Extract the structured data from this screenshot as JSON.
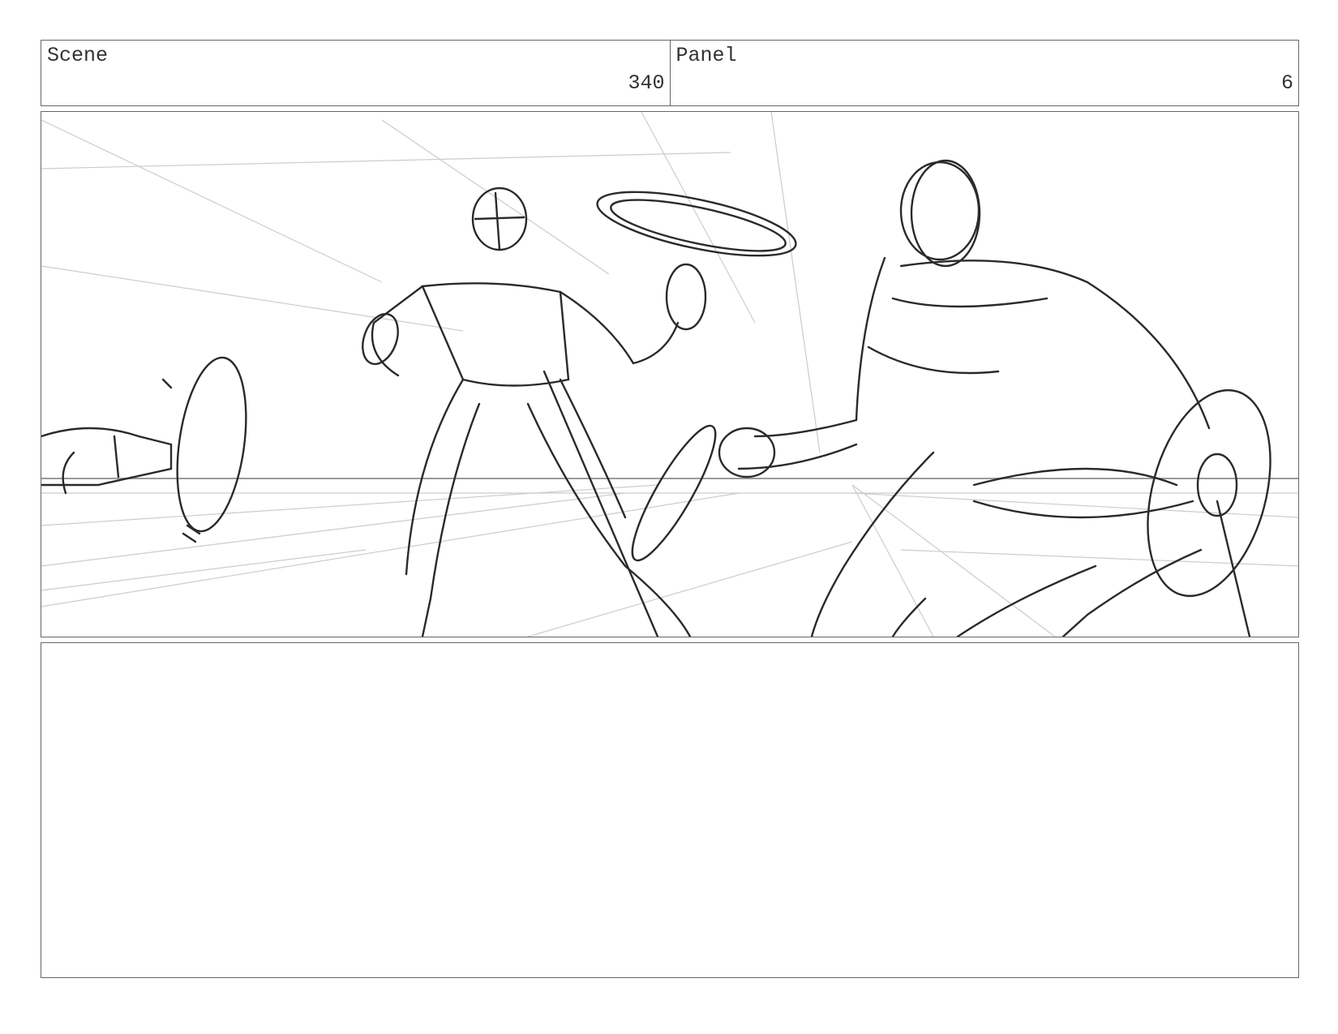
{
  "header": {
    "scene_label": "Scene",
    "scene_value": "340",
    "panel_label": "Panel",
    "panel_value": "6"
  },
  "notes": "",
  "colors": {
    "border": "#666666",
    "sketch_stroke": "#2a2a2a",
    "guide_stroke": "#c8c8c8"
  }
}
